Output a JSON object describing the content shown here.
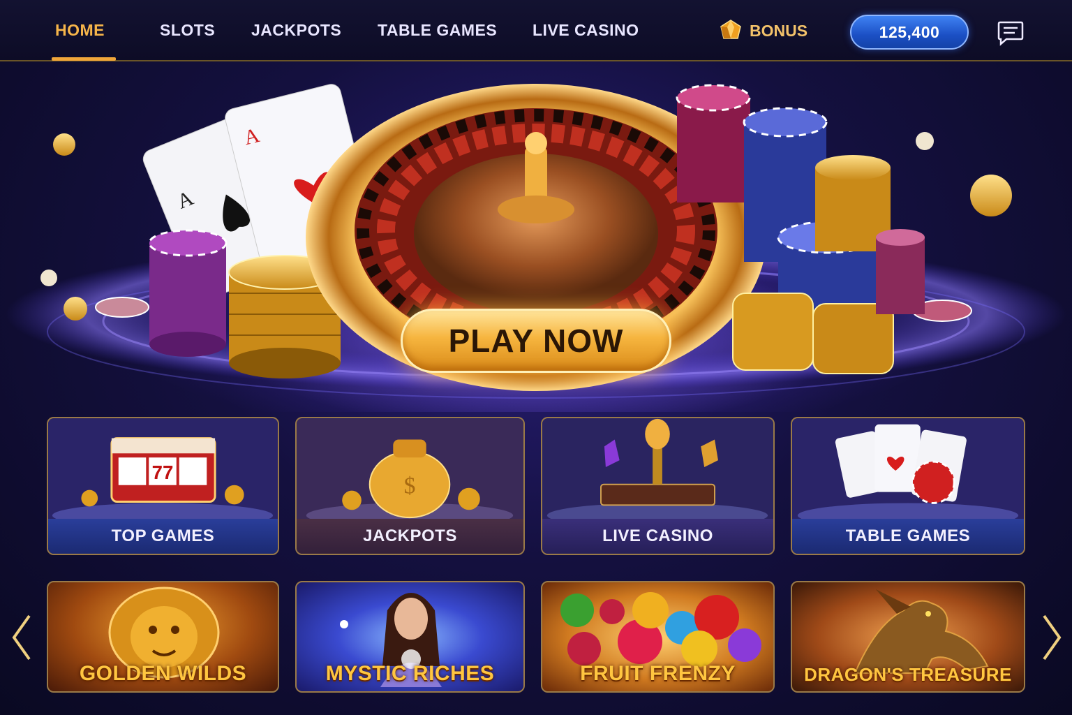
{
  "nav": {
    "items": [
      {
        "label": "HOME",
        "active": true
      },
      {
        "label": "SLOTS",
        "active": false
      },
      {
        "label": "JACKPOTS",
        "active": false
      },
      {
        "label": "TABLE GAMES",
        "active": false
      },
      {
        "label": "LIVE CASINO",
        "active": false
      }
    ],
    "bonus_label": "BONUS",
    "balance": "125,400",
    "menu_icon": "chat-menu-icon"
  },
  "hero": {
    "cta_label": "PLAY NOW",
    "card_letters": [
      "A",
      "A"
    ]
  },
  "categories": [
    {
      "label": "TOP GAMES",
      "icon": "slot-machine-icon",
      "slot_text": "77"
    },
    {
      "label": "JACKPOTS",
      "icon": "money-bag-icon"
    },
    {
      "label": "LIVE CASINO",
      "icon": "microphone-icon"
    },
    {
      "label": "TABLE GAMES",
      "icon": "playing-cards-icon"
    }
  ],
  "games": [
    {
      "title": "GOLDEN WILDS",
      "icon": "lion-icon"
    },
    {
      "title": "MYSTIC RICHES",
      "icon": "sorceress-icon"
    },
    {
      "title": "FRUIT FRENZY",
      "icon": "fruit-icon"
    },
    {
      "title": "DRAGON'S TREASURE",
      "icon": "dragon-icon"
    }
  ],
  "colors": {
    "accent_gold": "#f6b54a",
    "balance_blue": "#2a63d8",
    "background": "#14103f"
  }
}
